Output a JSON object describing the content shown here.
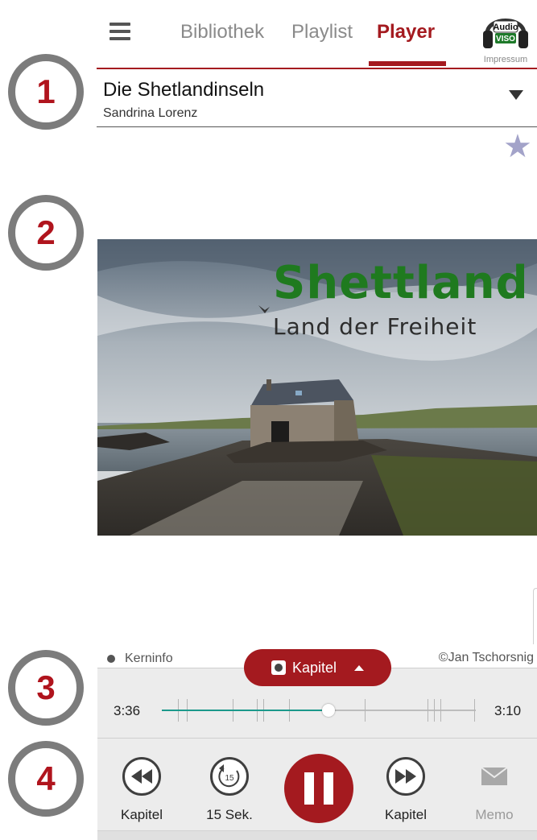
{
  "callouts": [
    "1",
    "2",
    "3",
    "4"
  ],
  "nav": {
    "tabs": [
      {
        "label": "Bibliothek",
        "active": false
      },
      {
        "label": "Playlist",
        "active": false
      },
      {
        "label": "Player",
        "active": true
      }
    ],
    "logo_line1": "Audio",
    "logo_line2": "VISO",
    "impressum": "Impressum"
  },
  "track": {
    "title": "Die Shetlandinseln",
    "author": "Sandrina Lorenz"
  },
  "cover": {
    "title": "Shettland",
    "subtitle": "Land der Freiheit"
  },
  "player": {
    "kerninfo": "Kerninfo",
    "chapter_chip": "Kapitel",
    "copyright": "©Jan Tschorsnig",
    "elapsed": "3:36",
    "remaining": "3:10",
    "progress_fraction": 0.53
  },
  "controls": {
    "prev_chapter": "Kapitel",
    "rewind_15": "15 Sek.",
    "rewind_15_badge": "15",
    "next_chapter": "Kapitel",
    "memo": "Memo"
  },
  "colors": {
    "accent": "#a41a1f",
    "progress": "#1b998b",
    "star": "#a3a3c9",
    "cover_title": "#1f7a1f"
  }
}
